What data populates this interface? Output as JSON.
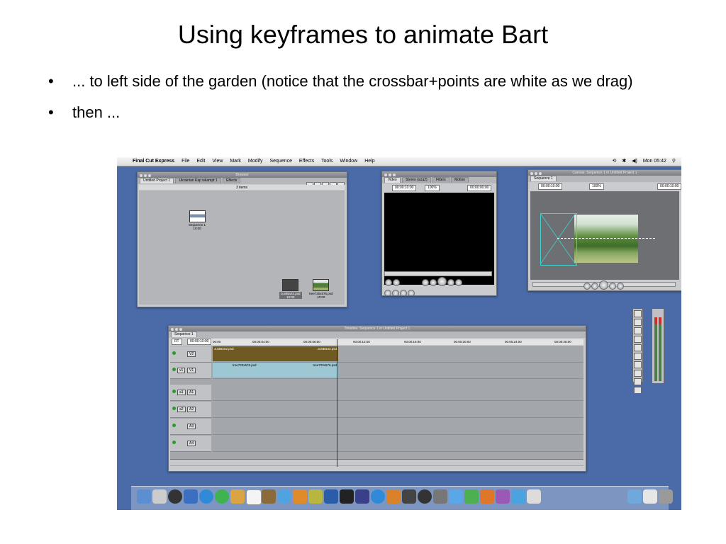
{
  "slide": {
    "title": "Using keyframes to animate Bart",
    "bullets": [
      "... to left side of the garden (notice that the crossbar+points are white as we drag)",
      "then ..."
    ]
  },
  "menubar": {
    "app": "Final Cut Express",
    "items": [
      "File",
      "Edit",
      "View",
      "Mark",
      "Modify",
      "Sequence",
      "Effects",
      "Tools",
      "Window",
      "Help"
    ],
    "clock": "Mon 05:42"
  },
  "browser": {
    "title": "Browser",
    "tabs": [
      "Untitled Project 1",
      "Ukrainian Kap wkampt 1",
      "Effects"
    ],
    "count": "3 items",
    "clips": [
      {
        "name": "Sequence 1",
        "duration": "10:00"
      },
      {
        "name": "JustBart2.psd",
        "duration": "10:00"
      },
      {
        "name": "tree720x576.psd",
        "duration": "10:00"
      }
    ]
  },
  "viewer": {
    "tabs": [
      "Video",
      "Stereo (a1a2)",
      "Filters",
      "Motion"
    ],
    "timecode_duration": "00:00:10:00",
    "zoom": "100%",
    "timecode_current": "00:00:00:00"
  },
  "canvas": {
    "title": "Canvas: Sequence 1 in Untitled Project 1",
    "tab": "Sequence 1",
    "timecode_duration": "00:00:10:00",
    "zoom": "100%",
    "timecode_current": "00:00:10:00"
  },
  "timeline": {
    "title": "Timeline: Sequence 1 in Untitled Project 1",
    "tab": "Sequence 1",
    "rt": "RT",
    "timecode": "00:00:10:00",
    "ruler": [
      "00:00",
      "00:00:04:00",
      "00:00:08:00",
      "00:00:12:00",
      "00:00:16:00",
      "00:00:20:00",
      "00:00:24:00",
      "00:00:28:00"
    ],
    "tracks": [
      {
        "a": "",
        "b": "V2",
        "clip_left": "JustBart2.psd",
        "clip_right": "JustBart2.psd"
      },
      {
        "a": "v1",
        "b": "V1",
        "clip_left": "tree720x576.psd",
        "clip_right": "tree720x576.psd"
      },
      {
        "a": "a1",
        "b": "A1"
      },
      {
        "a": "a2",
        "b": "A2"
      },
      {
        "a": "",
        "b": "A3"
      },
      {
        "a": "",
        "b": "A4"
      }
    ]
  }
}
